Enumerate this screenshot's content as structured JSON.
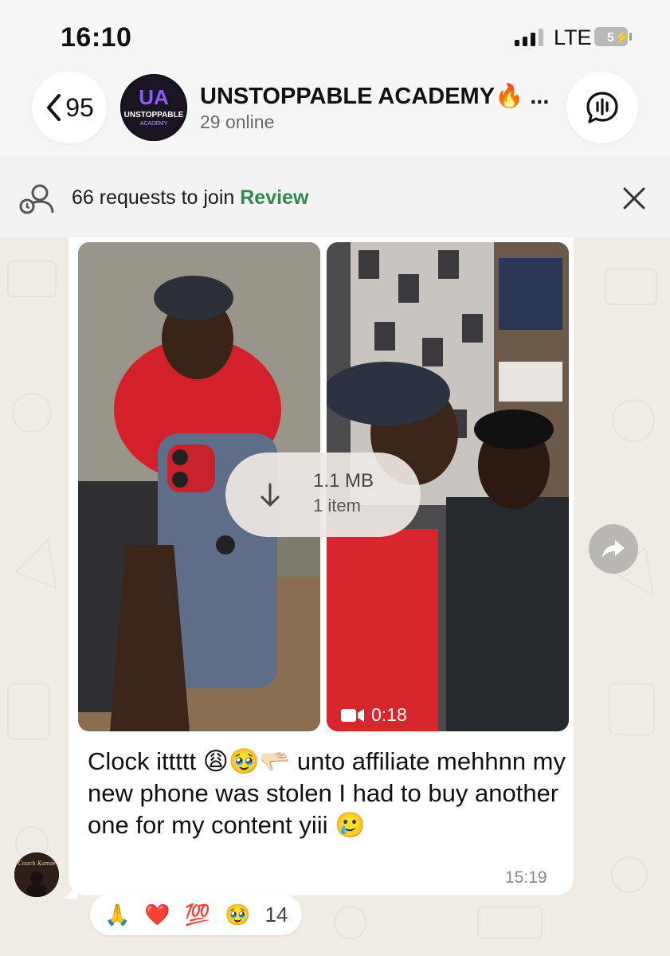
{
  "status_bar": {
    "time": "16:10",
    "network": "LTE",
    "battery": "5"
  },
  "header": {
    "back_count": "95",
    "title": "UNSTOPPABLE ACADEMY🔥 ...",
    "subtitle": "29 online",
    "avatar_text_top": "UA",
    "avatar_text_bottom": "UNSTOPPABLE",
    "avatar_text_sub": "ACADEMY"
  },
  "requests_banner": {
    "text": "66 requests to join",
    "action": "Review"
  },
  "message": {
    "download": {
      "size": "1.1 MB",
      "items": "1 item"
    },
    "video_duration": "0:18",
    "text": "Clock ittttt 😩🥹🫳🏻 unto affiliate mehhnn my new phone was stolen I had to buy another one for my content yiii 🥲",
    "time": "15:19",
    "sender_avatar_label": "Coach Kamie"
  },
  "reactions": {
    "emojis": [
      "🙏",
      "❤️",
      "💯",
      "🥹"
    ],
    "count": "14"
  },
  "colors": {
    "accent_green": "#2f8a4d",
    "chat_bg": "#f1ece3"
  }
}
